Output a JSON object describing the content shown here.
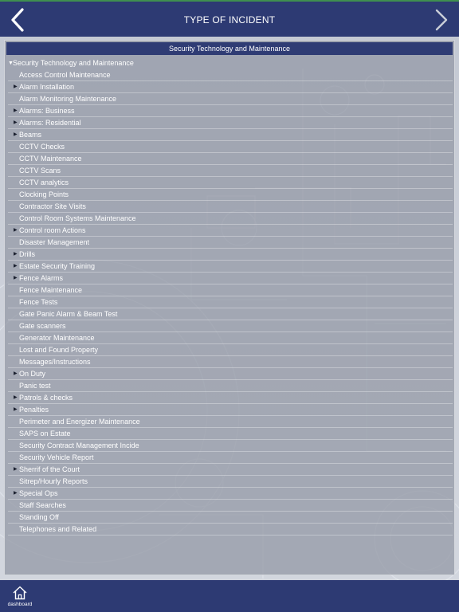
{
  "header": {
    "title": "TYPE OF INCIDENT",
    "back_icon": "chevron-left-icon",
    "forward_icon": "chevron-right-icon"
  },
  "panel": {
    "title": "Security Technology and Maintenance",
    "root_label": "Security Technology and Maintenance",
    "root_expanded": true
  },
  "items": [
    {
      "label": "Access Control Maintenance",
      "expandable": false
    },
    {
      "label": "Alarm Installation",
      "expandable": true
    },
    {
      "label": "Alarm Monitoring Maintenance",
      "expandable": false
    },
    {
      "label": "Alarms: Business",
      "expandable": true
    },
    {
      "label": "Alarms: Residential",
      "expandable": true
    },
    {
      "label": "Beams",
      "expandable": true
    },
    {
      "label": "CCTV Checks",
      "expandable": false
    },
    {
      "label": "CCTV Maintenance",
      "expandable": false
    },
    {
      "label": "CCTV Scans",
      "expandable": false
    },
    {
      "label": "CCTV analytics",
      "expandable": false
    },
    {
      "label": "Clocking Points",
      "expandable": false
    },
    {
      "label": "Contractor Site Visits",
      "expandable": false
    },
    {
      "label": "Control Room Systems Maintenance",
      "expandable": false
    },
    {
      "label": "Control room Actions",
      "expandable": true
    },
    {
      "label": "Disaster Management",
      "expandable": false
    },
    {
      "label": "Drills",
      "expandable": true
    },
    {
      "label": "Estate Security Training",
      "expandable": true
    },
    {
      "label": "Fence Alarms",
      "expandable": true
    },
    {
      "label": "Fence Maintenance",
      "expandable": false
    },
    {
      "label": "Fence Tests",
      "expandable": false
    },
    {
      "label": "Gate Panic Alarm & Beam Test",
      "expandable": false
    },
    {
      "label": "Gate scanners",
      "expandable": false
    },
    {
      "label": "Generator Maintenance",
      "expandable": false
    },
    {
      "label": "Lost and Found Property",
      "expandable": false
    },
    {
      "label": "Messages/Instructions",
      "expandable": false
    },
    {
      "label": "On Duty",
      "expandable": true
    },
    {
      "label": "Panic test",
      "expandable": false
    },
    {
      "label": "Patrols & checks",
      "expandable": true
    },
    {
      "label": "Penalties",
      "expandable": true
    },
    {
      "label": "Perimeter and Energizer Maintenance",
      "expandable": false
    },
    {
      "label": "SAPS on Estate",
      "expandable": false
    },
    {
      "label": "Security Contract Management Incide",
      "expandable": false
    },
    {
      "label": "Security Vehicle Report",
      "expandable": false
    },
    {
      "label": "Sherrif of the Court",
      "expandable": true
    },
    {
      "label": "Sitrep/Hourly Reports",
      "expandable": false
    },
    {
      "label": "Special Ops",
      "expandable": true
    },
    {
      "label": "Staff Searches",
      "expandable": false
    },
    {
      "label": "Standing Off",
      "expandable": false
    },
    {
      "label": "Telephones and Related",
      "expandable": false
    }
  ],
  "footer": {
    "dashboard_label": "dashboard",
    "dashboard_icon": "home-icon"
  },
  "colors": {
    "header_bg": "#2d3a73",
    "accent_line": "#3f8f4f",
    "text": "#ffffff"
  }
}
